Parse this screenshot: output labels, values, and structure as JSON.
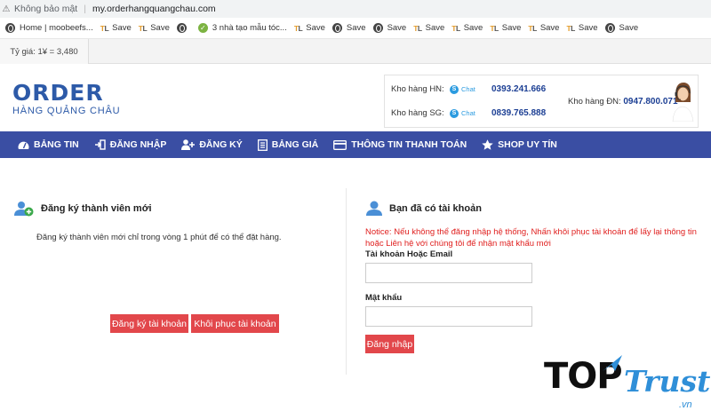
{
  "browser": {
    "security_label": "Không bảo mật",
    "url": "my.orderhangquangchau.com",
    "bookmarks": [
      {
        "icon": "globe-icon",
        "label": "Home | moobeefs..."
      },
      {
        "icon": "tl-icon",
        "label": "Save"
      },
      {
        "icon": "tl-icon",
        "label": "Save"
      },
      {
        "icon": "globe-icon",
        "label": ""
      },
      {
        "icon": "check-circle-icon",
        "label": "3 nhà tạo mẫu tóc..."
      },
      {
        "icon": "tl-icon",
        "label": "Save"
      },
      {
        "icon": "globe-icon",
        "label": "Save"
      },
      {
        "icon": "globe-icon",
        "label": "Save"
      },
      {
        "icon": "tl-icon",
        "label": "Save"
      },
      {
        "icon": "tl-icon",
        "label": "Save"
      },
      {
        "icon": "tl-icon",
        "label": "Save"
      },
      {
        "icon": "tl-icon",
        "label": "Save"
      },
      {
        "icon": "tl-icon",
        "label": "Save"
      },
      {
        "icon": "globe-icon",
        "label": "Save"
      }
    ]
  },
  "rate": "Tỷ giá: 1¥ = 3,480",
  "header": {
    "logo_main": "ORDER",
    "logo_sub": "HÀNG QUẢNG CHÂU",
    "hn_label": "Kho hàng HN:",
    "hn_chat": "Chat",
    "hn_phone": "0393.241.666",
    "sg_label": "Kho hàng SG:",
    "sg_chat": "Chat",
    "sg_phone": "0839.765.888",
    "dn_label": "Kho hàng ĐN:",
    "dn_phone": "0947.800.071"
  },
  "nav": [
    {
      "icon": "dashboard-icon",
      "label": "BẢNG TIN"
    },
    {
      "icon": "login-icon",
      "label": "ĐĂNG NHẬP"
    },
    {
      "icon": "add-user-icon",
      "label": "ĐĂNG KÝ"
    },
    {
      "icon": "price-list-icon",
      "label": "BẢNG GIÁ"
    },
    {
      "icon": "credit-card-icon",
      "label": "THÔNG TIN THANH TOÁN"
    },
    {
      "icon": "star-icon",
      "label": "SHOP UY TÍN"
    }
  ],
  "register": {
    "title": "Đăng ký thành viên mới",
    "description": "Đăng ký thành viên mới chỉ trong vòng 1 phút để có thể đặt hàng.",
    "register_button": "Đăng ký tài khoản",
    "recover_button": "Khôi phục tài khoản"
  },
  "login": {
    "title": "Bạn đã có tài khoản",
    "notice": "Notice: Nếu không thể đăng nhập hệ thống, Nhấn khôi phục tài khoản để lấy lại thông tin hoặc Liên hệ với chúng tôi để nhận mật khẩu mới",
    "username_label": "Tài khoản Hoặc Email",
    "username_value": "",
    "password_label": "Mật khẩu",
    "password_value": "",
    "login_button": "Đăng nhập"
  },
  "watermark": {
    "top": "TOP",
    "trust": "Trust",
    "vn": ".vn"
  },
  "colors": {
    "nav_bg": "#3a4ea3",
    "button_red": "#e2474b",
    "notice_red": "#e0201f",
    "phone_blue": "#1c3f94",
    "logo_blue": "#2d5aa8"
  }
}
